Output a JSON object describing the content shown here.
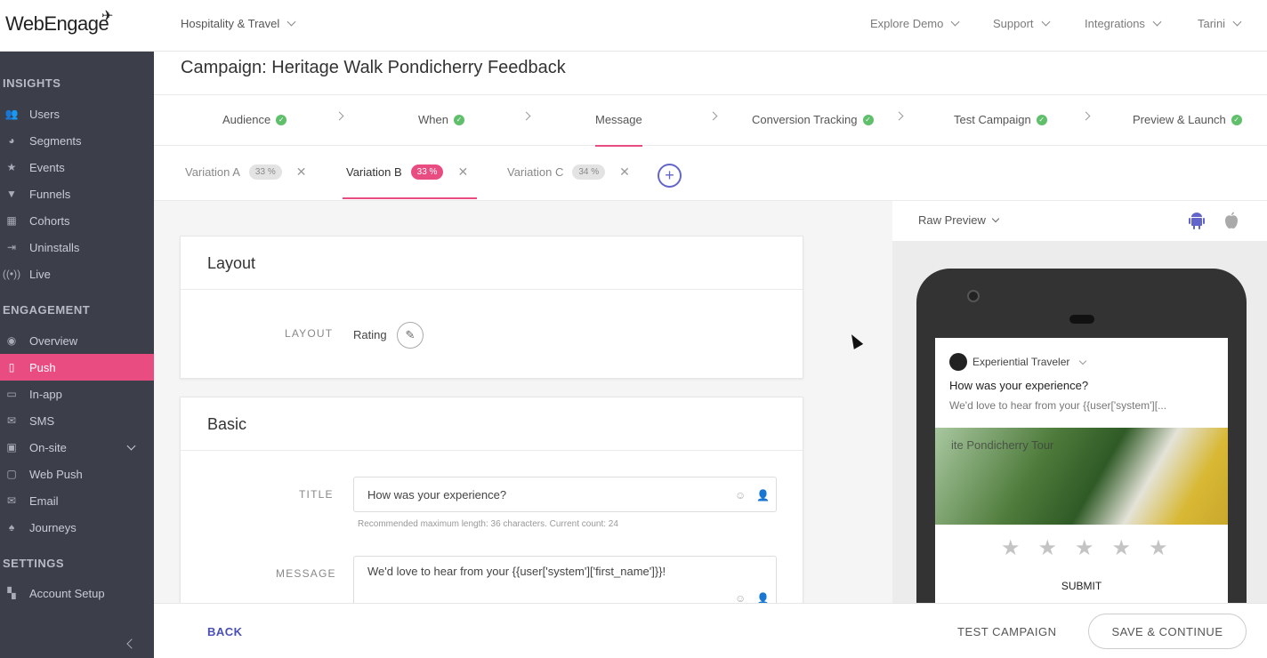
{
  "logo": {
    "text": "WebEngage"
  },
  "topbar": {
    "project": "Hospitality & Travel",
    "explore_demo": "Explore Demo",
    "support": "Support",
    "integrations": "Integrations",
    "user": "Tarini"
  },
  "sidebar": {
    "sections": {
      "insights": "INSIGHTS",
      "engagement": "ENGAGEMENT",
      "settings": "SETTINGS"
    },
    "insights": [
      {
        "label": "Users",
        "icon": "users-icon"
      },
      {
        "label": "Segments",
        "icon": "segments-icon"
      },
      {
        "label": "Events",
        "icon": "events-icon"
      },
      {
        "label": "Funnels",
        "icon": "funnels-icon"
      },
      {
        "label": "Cohorts",
        "icon": "cohorts-icon"
      },
      {
        "label": "Uninstalls",
        "icon": "uninstalls-icon"
      },
      {
        "label": "Live",
        "icon": "live-icon"
      }
    ],
    "engagement": [
      {
        "label": "Overview",
        "icon": "overview-icon"
      },
      {
        "label": "Push",
        "icon": "push-icon"
      },
      {
        "label": "In-app",
        "icon": "in-app-icon"
      },
      {
        "label": "SMS",
        "icon": "sms-icon"
      },
      {
        "label": "On-site",
        "icon": "on-site-icon"
      },
      {
        "label": "Web Push",
        "icon": "web-push-icon"
      },
      {
        "label": "Email",
        "icon": "email-icon"
      },
      {
        "label": "Journeys",
        "icon": "journeys-icon"
      }
    ],
    "settings": [
      {
        "label": "Account Setup",
        "icon": "account-setup-icon"
      }
    ]
  },
  "main": {
    "title": "Campaign: Heritage Walk Pondicherry Feedback",
    "steps": [
      {
        "label": "Audience"
      },
      {
        "label": "When"
      },
      {
        "label": "Message"
      },
      {
        "label": "Conversion Tracking"
      },
      {
        "label": "Test Campaign"
      },
      {
        "label": "Preview & Launch"
      }
    ],
    "variations": [
      {
        "label": "Variation A",
        "pct": "33 %"
      },
      {
        "label": "Variation B",
        "pct": "33 %"
      },
      {
        "label": "Variation C",
        "pct": "34 %"
      }
    ],
    "layout_card": {
      "title": "Layout",
      "label": "LAYOUT",
      "value": "Rating"
    },
    "basic_card": {
      "title": "Basic",
      "title_label": "TITLE",
      "title_value": "How was your experience?",
      "title_hint": "Recommended maximum length: 36 characters. Current count: 24",
      "message_label": "MESSAGE",
      "message_value": "We'd love to hear from your {{user['system']['first_name']}}!"
    }
  },
  "preview": {
    "mode": "Raw Preview",
    "app_name": "Experiential Traveler",
    "notif_title": "How was your experience?",
    "notif_message": "We'd love to hear from your {{user['system'][...",
    "image_caption": "ite Pondicherry Tour",
    "stars": [
      "★",
      "★",
      "★",
      "★",
      "★"
    ],
    "submit": "SUBMIT"
  },
  "bottom": {
    "back": "BACK",
    "test_campaign": "TEST CAMPAIGN",
    "save_continue": "SAVE & CONTINUE"
  },
  "colors": {
    "accent_pink": "#e84c80",
    "sidebar_bg": "#3c3e4a",
    "success_green": "#5fbf6b",
    "link_blue": "#4a4fb6"
  }
}
